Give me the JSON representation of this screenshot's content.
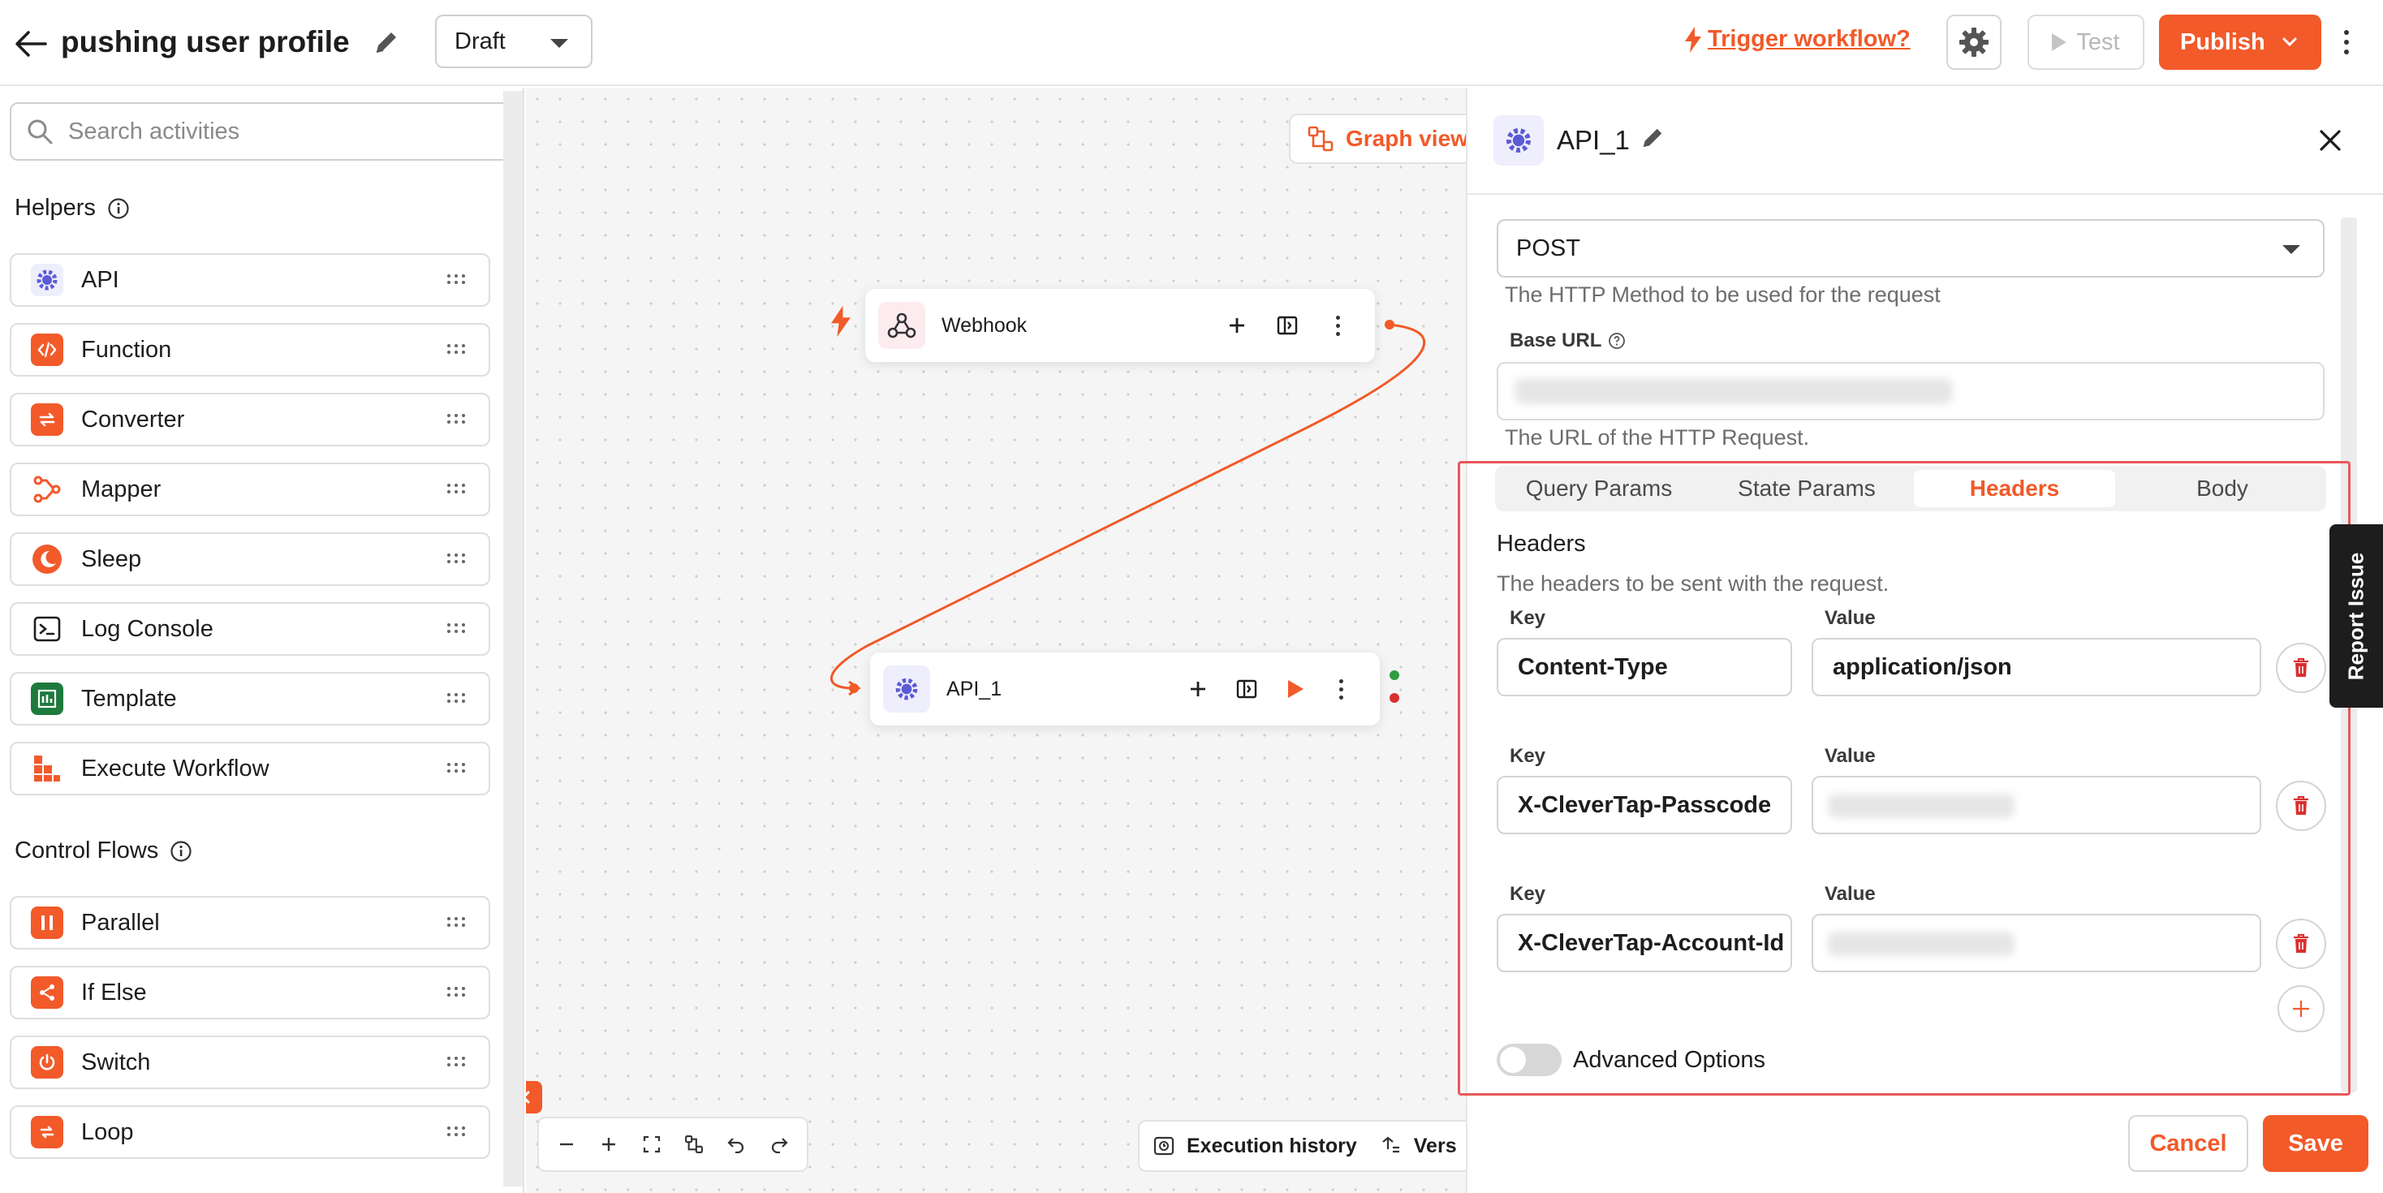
{
  "header": {
    "title": "pushing user profile",
    "status": "Draft",
    "trigger_link": "Trigger workflow?",
    "test_label": "Test",
    "publish_label": "Publish"
  },
  "sidebar": {
    "search_placeholder": "Search activities",
    "helpers_title": "Helpers",
    "helpers": [
      {
        "label": "API",
        "icon": "api-gear-icon",
        "color": "#5b5bd6"
      },
      {
        "label": "Function",
        "icon": "code-icon",
        "color": "#f25a2a"
      },
      {
        "label": "Converter",
        "icon": "convert-arrows-icon",
        "color": "#f25a2a"
      },
      {
        "label": "Mapper",
        "icon": "mapper-icon",
        "color": "#f25a2a"
      },
      {
        "label": "Sleep",
        "icon": "moon-icon",
        "color": "#f25a2a"
      },
      {
        "label": "Log Console",
        "icon": "terminal-icon",
        "color": "#1d1d1d"
      },
      {
        "label": "Template",
        "icon": "template-icon",
        "color": "#1e7a3c"
      },
      {
        "label": "Execute Workflow",
        "icon": "execute-workflow-icon",
        "color": "#f25a2a"
      }
    ],
    "control_title": "Control Flows",
    "controls": [
      {
        "label": "Parallel",
        "icon": "parallel-icon",
        "color": "#f25a2a"
      },
      {
        "label": "If Else",
        "icon": "branch-icon",
        "color": "#f25a2a"
      },
      {
        "label": "Switch",
        "icon": "power-icon",
        "color": "#f25a2a"
      },
      {
        "label": "Loop",
        "icon": "loop-icon",
        "color": "#f25a2a"
      }
    ]
  },
  "canvas": {
    "graph_view_label": "Graph view",
    "nodes": {
      "webhook": "Webhook",
      "api": "API_1"
    },
    "execution_history_label": "Execution history",
    "versions_label": "Vers"
  },
  "panel": {
    "title": "API_1",
    "method": "POST",
    "method_hint": "The HTTP Method to be used for the request",
    "base_url_label": "Base URL",
    "base_url_hint": "The URL of the HTTP Request.",
    "tabs": [
      "Query Params",
      "State Params",
      "Headers",
      "Body"
    ],
    "active_tab": "Headers",
    "headers_title": "Headers",
    "headers_desc": "The headers to be sent with the request.",
    "key_label": "Key",
    "value_label": "Value",
    "header_rows": [
      {
        "key": "Content-Type",
        "value": "application/json"
      },
      {
        "key": "X-CleverTap-Passcode",
        "value": ""
      },
      {
        "key": "X-CleverTap-Account-Id",
        "value": ""
      }
    ],
    "advanced_label": "Advanced Options",
    "report_issue": "Report Issue",
    "cancel_label": "Cancel",
    "save_label": "Save"
  },
  "colors": {
    "accent": "#f25a2a",
    "edge": "#f15a29",
    "success_dot": "#2e9e3e",
    "error_dot": "#d93030"
  }
}
